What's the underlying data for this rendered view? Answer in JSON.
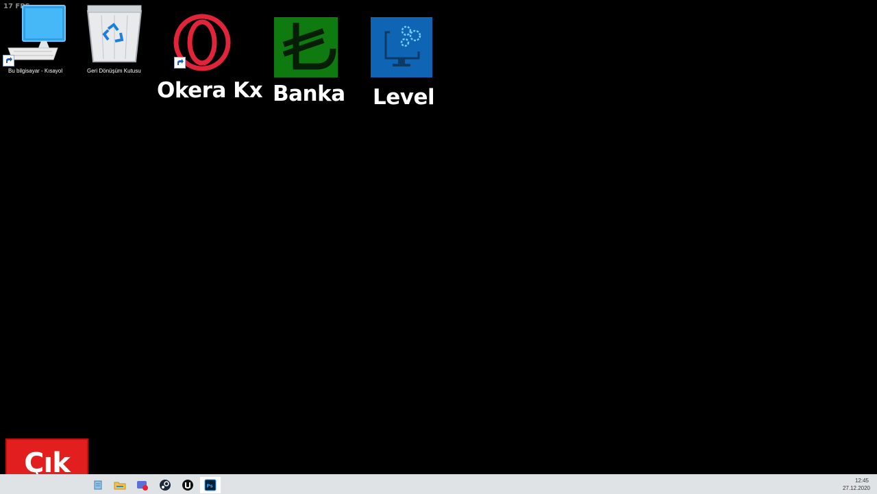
{
  "overlay": {
    "fps": "17 FPS"
  },
  "desktop": {
    "icons": [
      {
        "label": "Bu bilgisayar - Kısayol",
        "icon": "this-pc-icon",
        "shortcut": true
      },
      {
        "label": "Geri Dönüşüm Kutusu",
        "icon": "recycle-bin-icon",
        "shortcut": false
      },
      {
        "label": "Okera Kx",
        "icon": "opera-browser-icon",
        "shortcut": true
      },
      {
        "label": "Banka",
        "icon": "lira-currency-icon",
        "shortcut": false
      },
      {
        "label": "Level",
        "icon": "settings-monitor-icon",
        "shortcut": false
      }
    ]
  },
  "exit_button": {
    "label": "Çık",
    "color": "#e11f1f"
  },
  "taskbar": {
    "apps": [
      "file-icon",
      "folder-icon",
      "mail-app-icon",
      "steam-icon",
      "unreal-engine-icon",
      "photoshop-icon"
    ],
    "clock": {
      "time": "12:45",
      "date": "27.12.2020"
    }
  },
  "colors": {
    "desktop_bg": "#000000",
    "taskbar_bg": "#dfe3e6",
    "banka_bg": "#0f7a0f",
    "level_bg": "#1064b4",
    "opera_red": "#e0243a"
  }
}
